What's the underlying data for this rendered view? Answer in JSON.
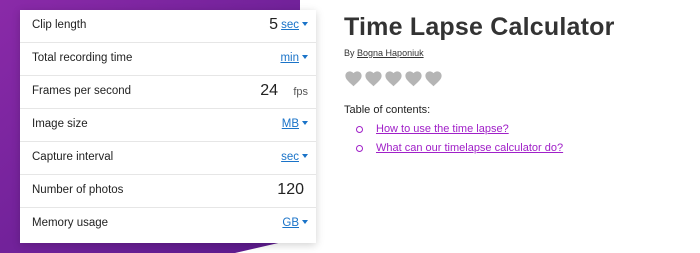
{
  "calculator": {
    "rows": [
      {
        "label": "Clip length",
        "value": "5",
        "unit": "sec",
        "unit_type": "select"
      },
      {
        "label": "Total recording time",
        "value": "",
        "unit": "min",
        "unit_type": "select"
      },
      {
        "label": "Frames per second",
        "value": "24",
        "unit": "fps",
        "unit_type": "static"
      },
      {
        "label": "Image size",
        "value": "",
        "unit": "MB",
        "unit_type": "select"
      },
      {
        "label": "Capture interval",
        "value": "",
        "unit": "sec",
        "unit_type": "select"
      },
      {
        "label": "Number of photos",
        "value": "120",
        "unit": "",
        "unit_type": "none"
      },
      {
        "label": "Memory usage",
        "value": "",
        "unit": "GB",
        "unit_type": "select"
      }
    ]
  },
  "article": {
    "title": "Time Lapse Calculator",
    "byline_prefix": "By",
    "author": "Bogna Haponiuk",
    "rating": {
      "filled": 0,
      "max": 5,
      "icon": "heart-icon"
    },
    "toc_label": "Table of contents:",
    "toc_items": [
      "How to use the time lapse?",
      "What can our timelapse calculator do?"
    ]
  },
  "colors": {
    "background_accent": "#6a1f9a",
    "link": "#a020c8",
    "unit_link": "#1a73c8",
    "heart": "#b5b5b5"
  }
}
